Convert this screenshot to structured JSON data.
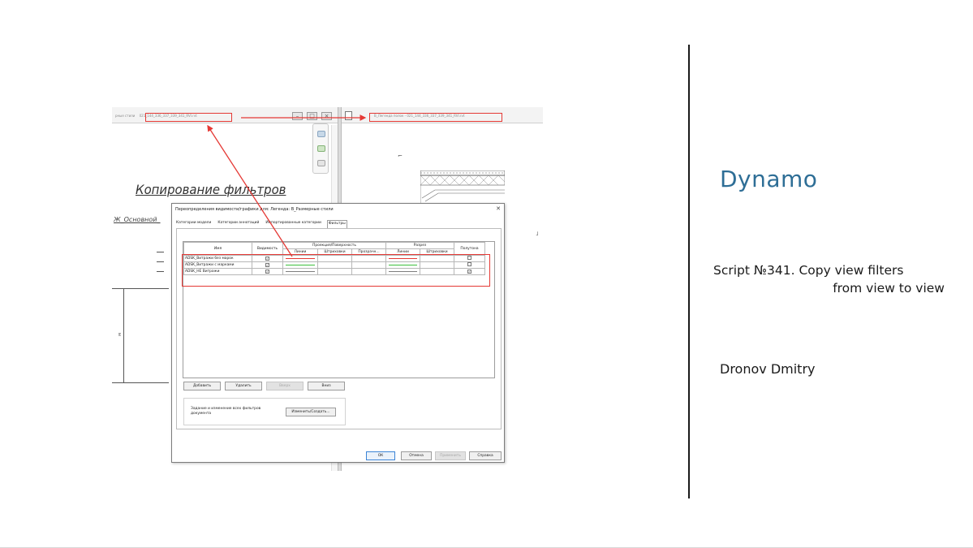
{
  "slide": {
    "product": "Dynamo",
    "script_line1": "Script №341. Copy view filters",
    "script_line2": "from view to view",
    "author": "Dronov Dmitry"
  },
  "revit": {
    "left_tab_title_prefix": "рные стили",
    "left_tab_title_file": "021_144_336_337_339_341_RVI.rvt",
    "right_tab_title": "В_Легенда полок - 021_144_336_337_339_341_RVI.rvt",
    "drawing_heading": "Копирование фильтров",
    "drawing_subheading": "Ж_Основной_",
    "dimension_label": "м"
  },
  "dialog": {
    "title": "Переопределения видимости/графики для: Легенда: В_Размерные стили",
    "close_glyph": "✕",
    "tabs": [
      "Категории модели",
      "Категории аннотаций",
      "Импортированные категории",
      "Фильтры"
    ],
    "active_tab": 3,
    "columns": {
      "name": "Имя",
      "visibility": "Видимость",
      "projection_group": "Проекция/Поверхность",
      "cut_group": "Разрез",
      "halftone": "Полутона",
      "lines": "Линии",
      "patterns": "Штриховки",
      "transparency": "Прозрачн..."
    },
    "rows": [
      {
        "name": "ADSK_Витражи без марок",
        "visible": true,
        "projection_line_color": "#e53935",
        "cut_line_color": "#e53935",
        "halftone": false
      },
      {
        "name": "ADSK_Витражи с марками",
        "visible": true,
        "projection_line_color": "#3bbf3b",
        "cut_line_color": "#3bbf3b",
        "halftone": false
      },
      {
        "name": "ADSK_НЕ Витражи",
        "visible": true,
        "projection_line_color": "#7d7d7d",
        "cut_line_color": "#7d7d7d",
        "halftone": true
      }
    ],
    "check_glyph": "✓",
    "buttons": {
      "add": "Добавить",
      "remove": "Удалить",
      "up": "Вверх",
      "down": "Вниз",
      "edit_create": "Изменить/Создать...",
      "ok": "ОК",
      "cancel": "Отмена",
      "apply": "Применить",
      "help": "Справка"
    },
    "group_text": "Задание и изменение всех фильтров документа"
  },
  "colors": {
    "annotation_red": "#e53935",
    "title_blue": "#2e6e96"
  }
}
